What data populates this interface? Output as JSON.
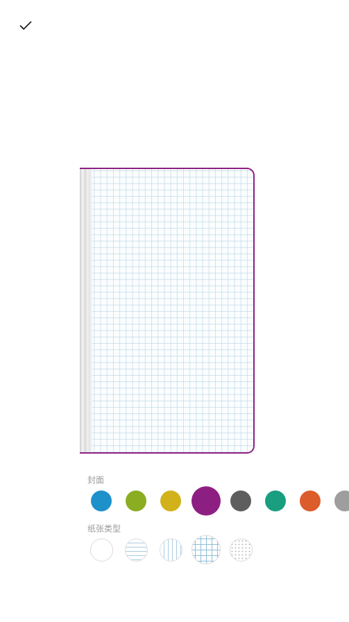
{
  "toolbar": {
    "done_icon": "checkmark-icon"
  },
  "cover": {
    "label": "封面",
    "selected": "purple",
    "colors": [
      {
        "name": "blue",
        "hex": "#1e91cb"
      },
      {
        "name": "green",
        "hex": "#8bad22"
      },
      {
        "name": "yellow",
        "hex": "#d2b21a"
      },
      {
        "name": "purple",
        "hex": "#8e1f82"
      },
      {
        "name": "gray",
        "hex": "#5e5e5e"
      },
      {
        "name": "teal",
        "hex": "#1a9e80"
      },
      {
        "name": "orange",
        "hex": "#dc5c2c"
      },
      {
        "name": "light-gray",
        "hex": "#9e9e9e"
      }
    ]
  },
  "paper": {
    "label": "纸张类型",
    "selected": "grid",
    "types": [
      "blank",
      "lined",
      "vertical",
      "grid",
      "dotted"
    ]
  },
  "preview": {
    "cover_color": "#8e1f82",
    "paper": "grid",
    "grid_color": "#aacde1"
  }
}
